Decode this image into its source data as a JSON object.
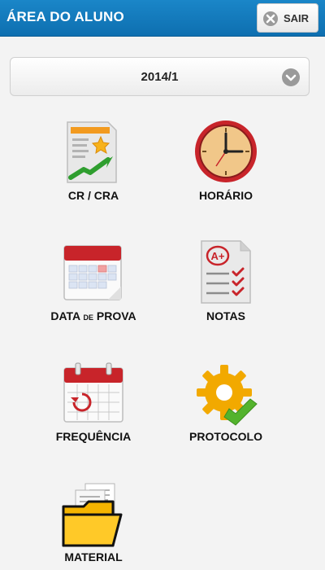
{
  "header": {
    "title": "ÁREA DO ALUNO",
    "logout_label": "SAIR"
  },
  "semester_select": {
    "value": "2014/1"
  },
  "menu": {
    "cr_cra": {
      "label": "CR / CRA"
    },
    "horario": {
      "label": "HORÁRIO"
    },
    "data_prova": {
      "label_main": "DATA",
      "label_small": "DE",
      "label_end": "PROVA"
    },
    "notas": {
      "label": "NOTAS",
      "badge": "A+"
    },
    "frequencia": {
      "label": "FREQUÊNCIA"
    },
    "protocolo": {
      "label": "PROTOCOLO"
    },
    "material": {
      "label": "MATERIAL"
    }
  },
  "colors": {
    "header": "#0e6fb0",
    "accent_red": "#d93a2b",
    "gear_yellow": "#f2a900",
    "check_green": "#53b32d"
  }
}
